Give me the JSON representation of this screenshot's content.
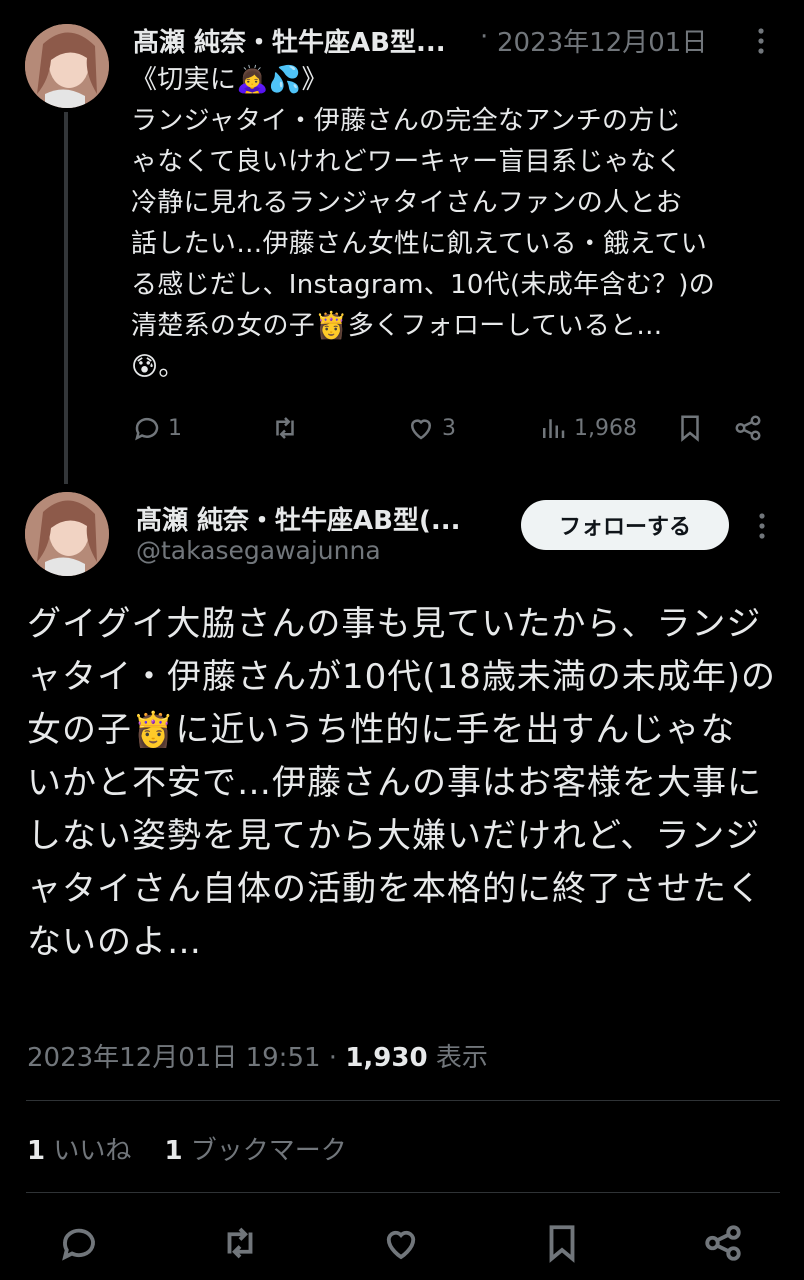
{
  "quoted_tweet": {
    "author_name": "髙瀬 純奈・牡牛座AB型...",
    "separator": "·",
    "date": "2023年12月01日",
    "lines": [
      "《切実に🙇‍♀️💦》",
      "ランジャタイ・伊藤さんの完全なアンチの方じ",
      "ゃなくて良いけれどワーキャー盲目系じゃなく",
      "冷静に見れるランジャタイさんファンの人とお",
      "話したい…伊藤さん女性に飢えている・餓えてい",
      "る感じだし、Instagram、10代(未成年含む？)の",
      "清楚系の女の子👸多くフォローしていると…",
      "😰。"
    ],
    "stats": {
      "replies": "1",
      "likes": "3",
      "views": "1,968"
    }
  },
  "main_tweet": {
    "author_name": "髙瀬 純奈・牡牛座AB型(...",
    "handle": "@takasegawajunna",
    "follow_label": "フォローする",
    "lines": [
      "グイグイ大脇さんの事も見ていたから、ランジ",
      "ャタイ・伊藤さんが10代(18歳未満の未成年)の",
      "女の子👸に近いうち性的に手を出すんじゃな",
      "いかと不安で…伊藤さんの事はお客様を大事に",
      "しない姿勢を見てから大嫌いだけれど、ランジ",
      "ャタイさん自体の活動を本格的に終了させたく",
      "ないのよ…"
    ],
    "timestamp": "2023年12月01日 19:51",
    "separator": "·",
    "views_count": "1,930",
    "views_label": "表示",
    "likes_count": "1",
    "likes_label": "いいね",
    "bookmarks_count": "1",
    "bookmarks_label": "ブックマーク"
  },
  "icons": {
    "reply": "reply-icon",
    "retweet": "retweet-icon",
    "like": "heart-icon",
    "views": "views-icon",
    "bookmark": "bookmark-icon",
    "share": "share-icon",
    "more": "more-icon"
  },
  "colors": {
    "background": "#000000",
    "text": "#e7e9ea",
    "muted": "#71767b",
    "follow_bg": "#eff3f4"
  }
}
